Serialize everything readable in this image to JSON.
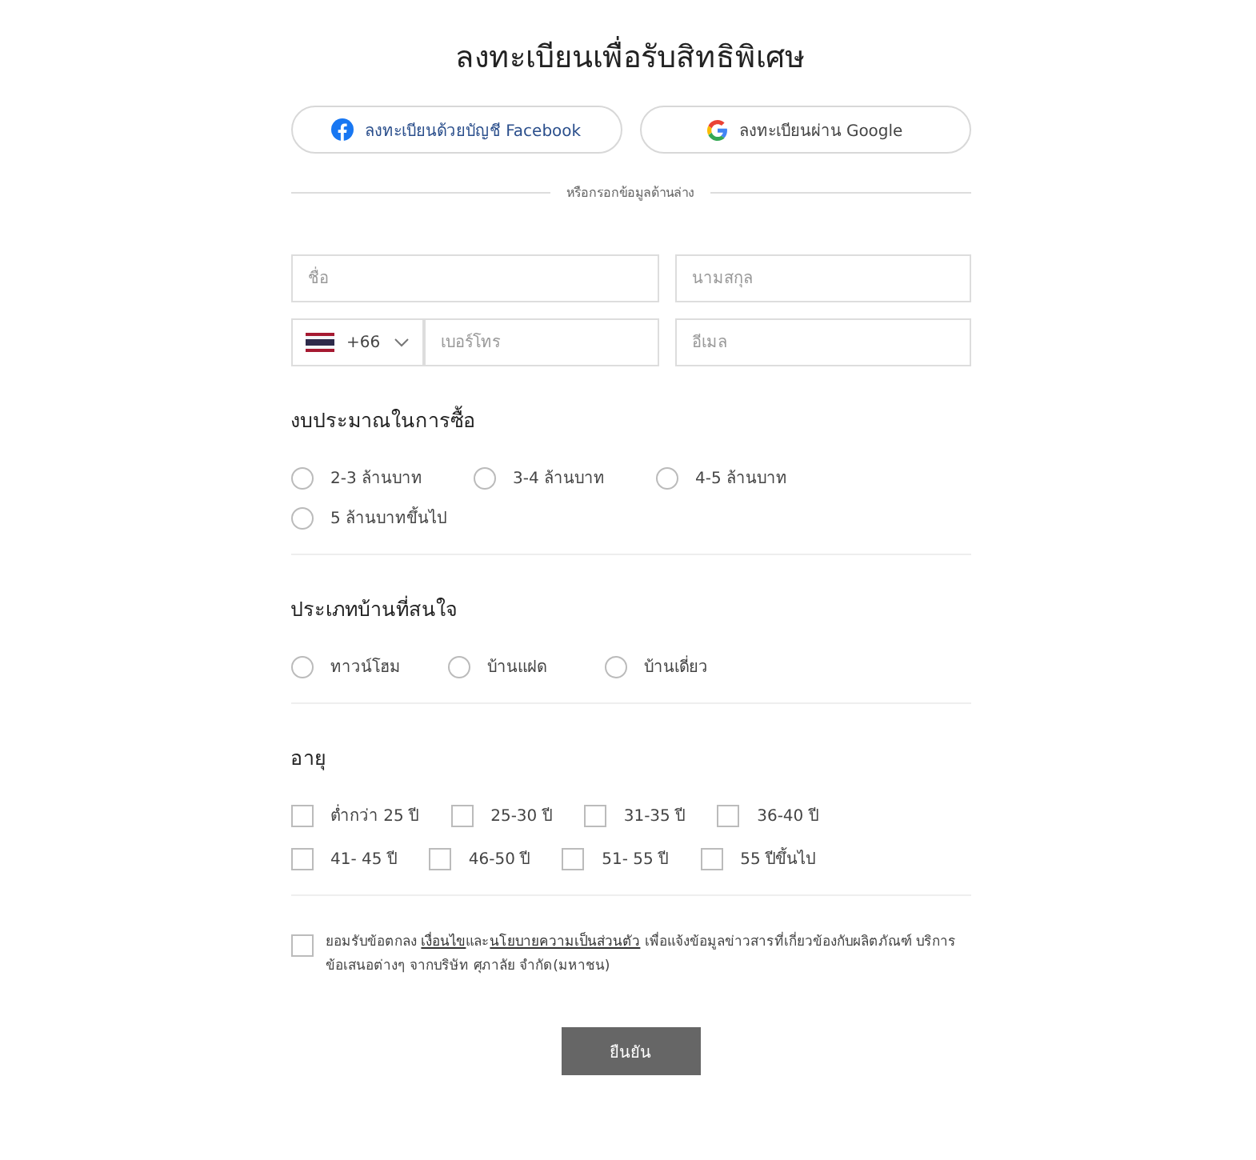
{
  "title": "ลงทะเบียนเพื่อรับสิทธิพิเศษ",
  "social_buttons": [
    {
      "kind": "facebook",
      "label": "ลงทะเบียนด้วยบัญชี Facebook"
    },
    {
      "kind": "google",
      "label": "ลงทะเบียนผ่าน Google"
    }
  ],
  "divider_text": "หรือกรอกข้อมูลด้านล่าง",
  "fields": {
    "first_name": {
      "placeholder": "ชื่อ"
    },
    "last_name": {
      "placeholder": "นามสกุล"
    },
    "country_code": "+66",
    "phone": {
      "placeholder": "เบอร์โทร"
    },
    "email": {
      "placeholder": "อีเมล"
    }
  },
  "budget": {
    "heading": "งบประมาณในการซื้อ",
    "options": [
      {
        "label": "2-3 ล้านบาท",
        "selected": false
      },
      {
        "label": "3-4 ล้านบาท",
        "selected": false
      },
      {
        "label": "4-5 ล้านบาท",
        "selected": false
      },
      {
        "label": "5 ล้านบาทขึ้นไป",
        "selected": false
      }
    ]
  },
  "house_type": {
    "heading": "ประเภทบ้านที่สนใจ",
    "options": [
      {
        "label": "ทาวน์โฮม",
        "selected": false
      },
      {
        "label": "บ้านแฝด",
        "selected": false
      },
      {
        "label": "บ้านเดี่ยว",
        "selected": false
      }
    ]
  },
  "age": {
    "heading": "อายุ",
    "rows": [
      [
        {
          "label": "ต่ำกว่า 25 ปี",
          "checked": false
        },
        {
          "label": "25-30 ปี",
          "checked": false
        },
        {
          "label": "31-35 ปี",
          "checked": false
        },
        {
          "label": "36-40 ปี",
          "checked": false
        }
      ],
      [
        {
          "label": "41- 45 ปี",
          "checked": false
        },
        {
          "label": "46-50 ปี",
          "checked": false
        },
        {
          "label": "51- 55 ปี",
          "checked": false
        },
        {
          "label": "55 ปีขึ้นไป",
          "checked": false
        }
      ]
    ]
  },
  "consent": {
    "checked": false,
    "parts": [
      {
        "kind": "text",
        "text": "ยอมรับข้อตกลง "
      },
      {
        "kind": "link",
        "text": "เงื่อนไข"
      },
      {
        "kind": "text",
        "text": "และ"
      },
      {
        "kind": "link",
        "text": "นโยบายความเป็นส่วนตัว"
      },
      {
        "kind": "text",
        "text": " เพื่อแจ้งข้อมูลข่าวสารที่เกี่ยวข้องกับผลิตภัณฑ์ บริการ ข้อเสนอต่างๆ จากบริษัท ศุภาลัย จำกัด(มหาชน)"
      }
    ]
  },
  "submit": "ยืนยัน"
}
